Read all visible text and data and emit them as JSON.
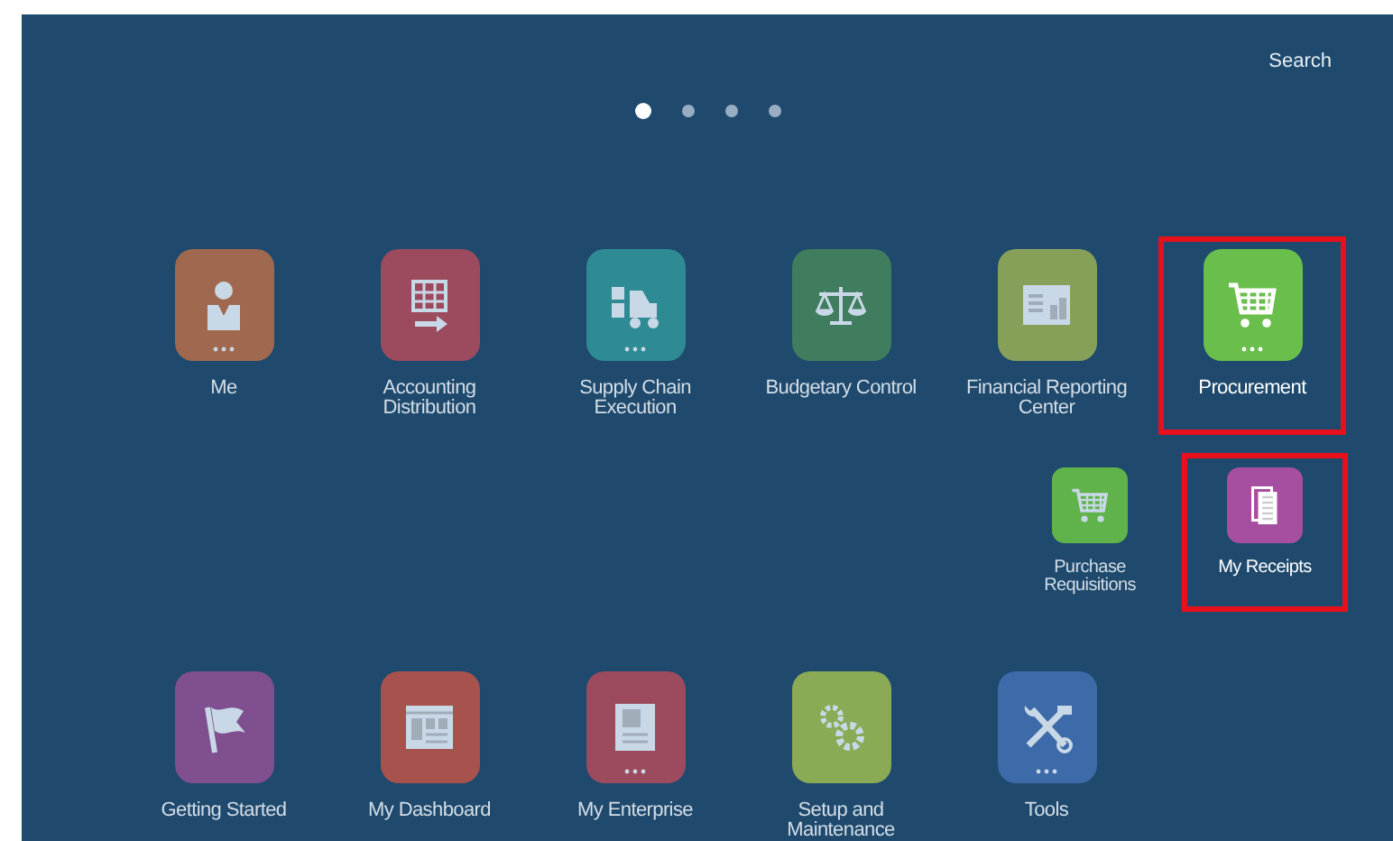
{
  "search": {
    "label": "Search"
  },
  "page_dots": [
    {
      "selected": true
    },
    {
      "selected": false
    },
    {
      "selected": false
    },
    {
      "selected": false
    }
  ],
  "rows": [
    {
      "tiles": [
        {
          "label": "Me",
          "kind": "person",
          "color": "#a0694f",
          "more": true,
          "highlighted": false
        },
        {
          "label": "Accounting Distribution",
          "kind": "ledger",
          "color": "#9c4a5e",
          "more": false,
          "highlighted": false
        },
        {
          "label": "Supply Chain Execution",
          "kind": "forklift",
          "color": "#2e8a93",
          "more": true,
          "highlighted": false
        },
        {
          "label": "Budgetary Control",
          "kind": "scales",
          "color": "#3f7d5e",
          "more": false,
          "highlighted": false
        },
        {
          "label": "Financial Reporting Center",
          "kind": "report",
          "color": "#86a05a",
          "more": false,
          "highlighted": false
        },
        {
          "label": "Procurement",
          "kind": "cart",
          "color": "#69be4c",
          "more": true,
          "highlighted": true
        }
      ]
    },
    {
      "kind": "sub",
      "tiles": [
        {
          "label": "Purchase Requisitions",
          "kind": "cart",
          "color": "#5fb34a",
          "more": false,
          "highlighted": false
        },
        {
          "label": "My Receipts",
          "kind": "receipt",
          "color": "#a64fa0",
          "more": false,
          "highlighted": true
        }
      ]
    },
    {
      "tiles": [
        {
          "label": "Getting Started",
          "kind": "flag",
          "color": "#7f4f90",
          "more": false,
          "highlighted": false
        },
        {
          "label": "My Dashboard",
          "kind": "dashboard",
          "color": "#a8524e",
          "more": false,
          "highlighted": false
        },
        {
          "label": "My Enterprise",
          "kind": "building",
          "color": "#9c4a5e",
          "more": true,
          "highlighted": false
        },
        {
          "label": "Setup and Maintenance",
          "kind": "gears",
          "color": "#8aaa55",
          "more": false,
          "highlighted": false
        },
        {
          "label": "Tools",
          "kind": "tools",
          "color": "#3d6aa8",
          "more": true,
          "highlighted": false
        }
      ]
    }
  ]
}
